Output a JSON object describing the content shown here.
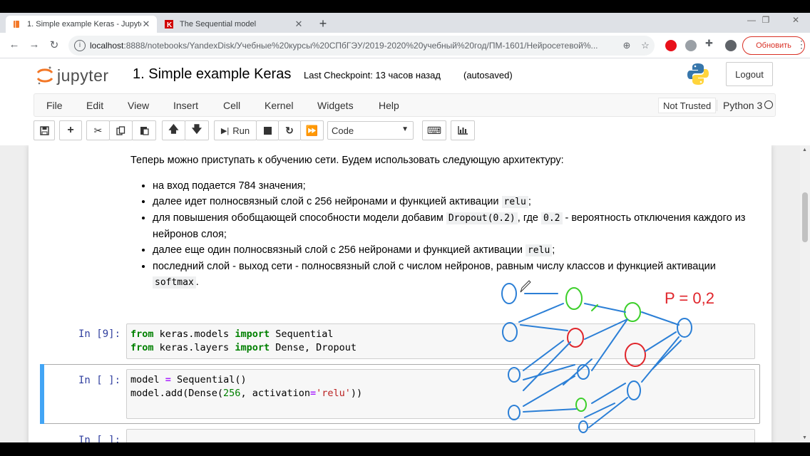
{
  "browser": {
    "tabs": [
      {
        "title": "1. Simple example Keras - Jupyte",
        "active": true,
        "favicon": "jupyter-book-icon"
      },
      {
        "title": "The Sequential model",
        "active": false,
        "favicon": "keras-k-icon"
      }
    ],
    "new_tab_symbol": "+",
    "url_host": "localhost",
    "url_path": ":8888/notebooks/YandexDisk/Учебные%20курсы%20СПбГЭУ/2019-2020%20учебный%20год/ПМ-1601/Нейросетевой%...",
    "update_button": "Обновить",
    "colors": {
      "update_red": "#d93025",
      "tab_strip": "#dee1e6"
    }
  },
  "jupyter": {
    "logo_text": "jupyter",
    "notebook_title": "1. Simple example Keras",
    "checkpoint": "Last Checkpoint: 13 часов назад",
    "autosaved": "(autosaved)",
    "logout": "Logout",
    "menu": [
      "File",
      "Edit",
      "View",
      "Insert",
      "Cell",
      "Kernel",
      "Widgets",
      "Help"
    ],
    "trust_status": "Not Trusted",
    "kernel": "Python 3",
    "toolbar": {
      "run_label": "Run",
      "cell_type": "Code"
    }
  },
  "notebook": {
    "markdown_intro": "Теперь можно приступать к обучению сети. Будем использовать следующую архитектуру:",
    "bullets": [
      {
        "text": "на вход подается 784 значения;"
      },
      {
        "pre": "далее идет полносвязный слой с 256 нейронами и функцией активации ",
        "code": "relu",
        "post": ";"
      },
      {
        "pre": "для повышения обобщающей способности модели добавим ",
        "code": "Dropout(0.2)",
        "mid": ", где ",
        "code2": "0.2",
        "post": " - вероятность отключения каждого из нейронов слоя;"
      },
      {
        "pre": "далее еще один полносвязный слой с 256 нейронами и функцией активации ",
        "code": "relu",
        "post": ";"
      },
      {
        "pre": "последний слой - выход сети - полносвязный слой с числом нейронов, равным числу классов и функцией активации ",
        "code": "softmax",
        "post": "."
      }
    ],
    "cells": [
      {
        "prompt": "In [9]:",
        "lines": [
          [
            {
              "t": "from",
              "c": "kw"
            },
            {
              "t": " keras.models "
            },
            {
              "t": "import",
              "c": "kw"
            },
            {
              "t": " Sequential"
            }
          ],
          [
            {
              "t": "from",
              "c": "kw"
            },
            {
              "t": " keras.layers "
            },
            {
              "t": "import",
              "c": "kw"
            },
            {
              "t": " Dense, Dropout"
            }
          ]
        ]
      },
      {
        "prompt": "In [ ]:",
        "selected": true,
        "lines": [
          [
            {
              "t": "model "
            },
            {
              "t": "=",
              "c": "op"
            },
            {
              "t": " Sequential()"
            }
          ],
          [
            {
              "t": "model.add(Dense("
            },
            {
              "t": "256",
              "c": "num"
            },
            {
              "t": ", activation"
            },
            {
              "t": "=",
              "c": "op"
            },
            {
              "t": "'relu'",
              "c": "str"
            },
            {
              "t": "))"
            }
          ]
        ]
      },
      {
        "prompt": "In [ ]:",
        "lines": []
      }
    ],
    "annotation_text": "P = 0,2",
    "annotation_colors": {
      "blue": "#2b7fd6",
      "green": "#3ccf2a",
      "red": "#e0262c",
      "text_red": "#e0262c"
    }
  }
}
